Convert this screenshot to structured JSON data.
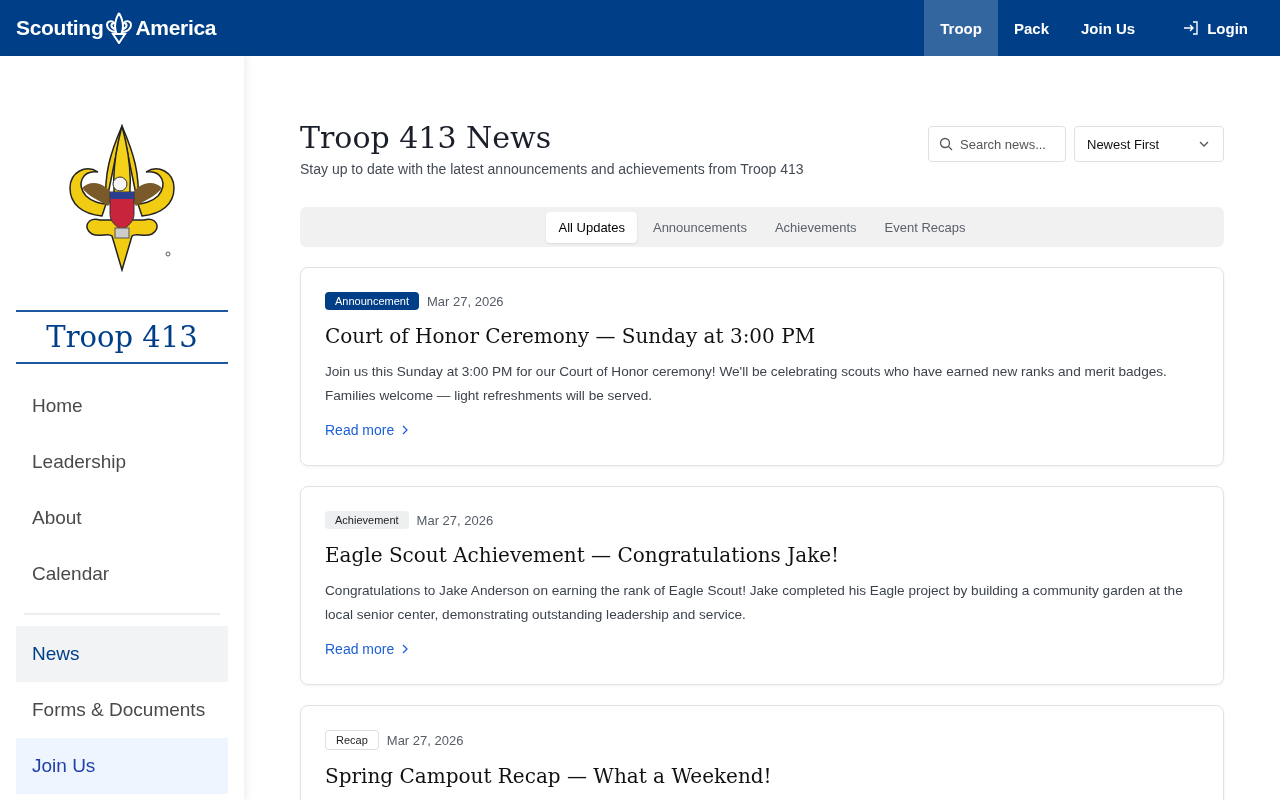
{
  "header": {
    "brand_left": "Scouting",
    "brand_right": "America",
    "nav": [
      {
        "label": "Troop",
        "selected": true
      },
      {
        "label": "Pack",
        "selected": false
      },
      {
        "label": "Join Us",
        "selected": false
      }
    ],
    "login": "Login"
  },
  "sidebar": {
    "title": "Troop 413",
    "items": [
      {
        "label": "Home",
        "kind": "plain",
        "selected": false
      },
      {
        "label": "Leadership",
        "kind": "plain",
        "selected": false
      },
      {
        "label": "About",
        "kind": "plain",
        "selected": false
      },
      {
        "label": "Calendar",
        "kind": "plain",
        "selected": false
      },
      {
        "kind": "divider"
      },
      {
        "label": "News",
        "kind": "plain",
        "selected": true
      },
      {
        "label": "Forms & Documents",
        "kind": "plain",
        "selected": false
      },
      {
        "label": "Join Us",
        "kind": "highlight",
        "selected": false
      }
    ]
  },
  "page": {
    "title": "Troop 413 News",
    "subtitle": "Stay up to date with the latest announcements and achievements from Troop 413",
    "search": {
      "placeholder": "Search news..."
    },
    "sort": {
      "value": "Newest First"
    }
  },
  "tabs": [
    {
      "label": "All Updates",
      "selected": true
    },
    {
      "label": "Announcements",
      "selected": false
    },
    {
      "label": "Achievements",
      "selected": false
    },
    {
      "label": "Event Recaps",
      "selected": false
    }
  ],
  "posts": [
    {
      "tag": "Announcement",
      "kind": "announcement",
      "date": "Mar 27, 2026",
      "title": "Court of Honor Ceremony — Sunday at 3:00 PM",
      "body": "Join us this Sunday at 3:00 PM for our Court of Honor ceremony! We'll be celebrating scouts who have earned new ranks and merit badges. Families welcome — light refreshments will be served.",
      "link": "Read more"
    },
    {
      "tag": "Achievement",
      "kind": "achievement",
      "date": "Mar 27, 2026",
      "title": "Eagle Scout Achievement — Congratulations Jake!",
      "body": "Congratulations to Jake Anderson on earning the rank of Eagle Scout! Jake completed his Eagle project by building a community garden at the local senior center, demonstrating outstanding leadership and service.",
      "link": "Read more"
    },
    {
      "tag": "Recap",
      "kind": "recap",
      "date": "Mar 27, 2026",
      "title": "Spring Campout Recap — What a Weekend!"
    }
  ]
}
